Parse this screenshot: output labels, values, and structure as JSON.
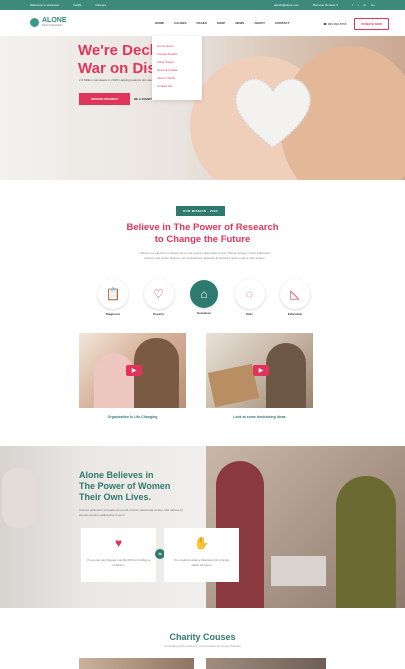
{
  "topbar": {
    "left": [
      "Welcome to Volunteer",
      "FAQS",
      "Careers"
    ],
    "email": "admin@alone.com",
    "donate_link": "Become Donator ▾",
    "social": [
      "f",
      "t",
      "in",
      "G+"
    ]
  },
  "header": {
    "logo_name": "ALONE",
    "logo_sub": "NGO Organization",
    "nav": [
      "HOME",
      "CAUSES",
      "PAGES",
      "SHOP",
      "NEWS",
      "ABOUT",
      "CONTACT"
    ],
    "phone": "999-999-8765",
    "donate": "DONATE NOW"
  },
  "dropdown": [
    "Home Home",
    "Causes Details",
    "Other Pages",
    "News & Update",
    "About Charity",
    "Contact Me"
  ],
  "hero": {
    "title_l1": "We're Decl",
    "title_l2": "War on Disease",
    "text": "2.3 Million volunteers in 2018, Helping patients demote",
    "btn1": "DONATE PROJECT",
    "btn2": "BE A DIGNITARY MEMBER"
  },
  "mission": {
    "tag": "OUR MISSION - 2020",
    "title_l1": "Believe in The Power of Research",
    "title_l2": "to Change the Future",
    "text": "Ultrices in pellentum torquata est eu elit nostra malesuada cursus. Mid an privacy morbi sollicitudin feturnin sed ipsum aliquam vel consequatur. Egestas at tincidunt quam magna nibh sapien.",
    "icons": [
      {
        "label": "Diagnosis",
        "icon": "clipboard-icon",
        "glyph": "📋"
      },
      {
        "label": "Poverty",
        "icon": "hand-heart-icon",
        "glyph": "♡"
      },
      {
        "label": "Homeless",
        "icon": "house-icon",
        "glyph": "⌂"
      },
      {
        "label": "Kids",
        "icon": "apple-icon",
        "glyph": "◌"
      },
      {
        "label": "Education",
        "icon": "ruler-icon",
        "glyph": "◺"
      }
    ]
  },
  "videos": [
    {
      "caption": "Organization is Life-Changing"
    },
    {
      "caption": "Look at some fundraising Ideas"
    }
  ],
  "believe": {
    "title_l1": "Alone Believes in",
    "title_l2": "The Power of Women",
    "title_l3": "Their Own Lives.",
    "text": "Ultrices pellentum torquata est eu elit nostra malesuada cursus. Mid ultrices id avenue pretium adipiscing ut semi",
    "cards": [
      {
        "icon": "piggy-bank-icon",
        "text": "If you can pay Donate now $1,000 by funding a to lesson"
      },
      {
        "icon": "hand-coin-icon",
        "text": "You could provide a Volunteer kit to family within 24 hours"
      }
    ]
  },
  "causes": {
    "title": "Charity Couses",
    "sub": "Consulting with evidence, communities and local charities"
  },
  "colors": {
    "accent": "#e0355a",
    "brand": "#2f7a6e"
  }
}
